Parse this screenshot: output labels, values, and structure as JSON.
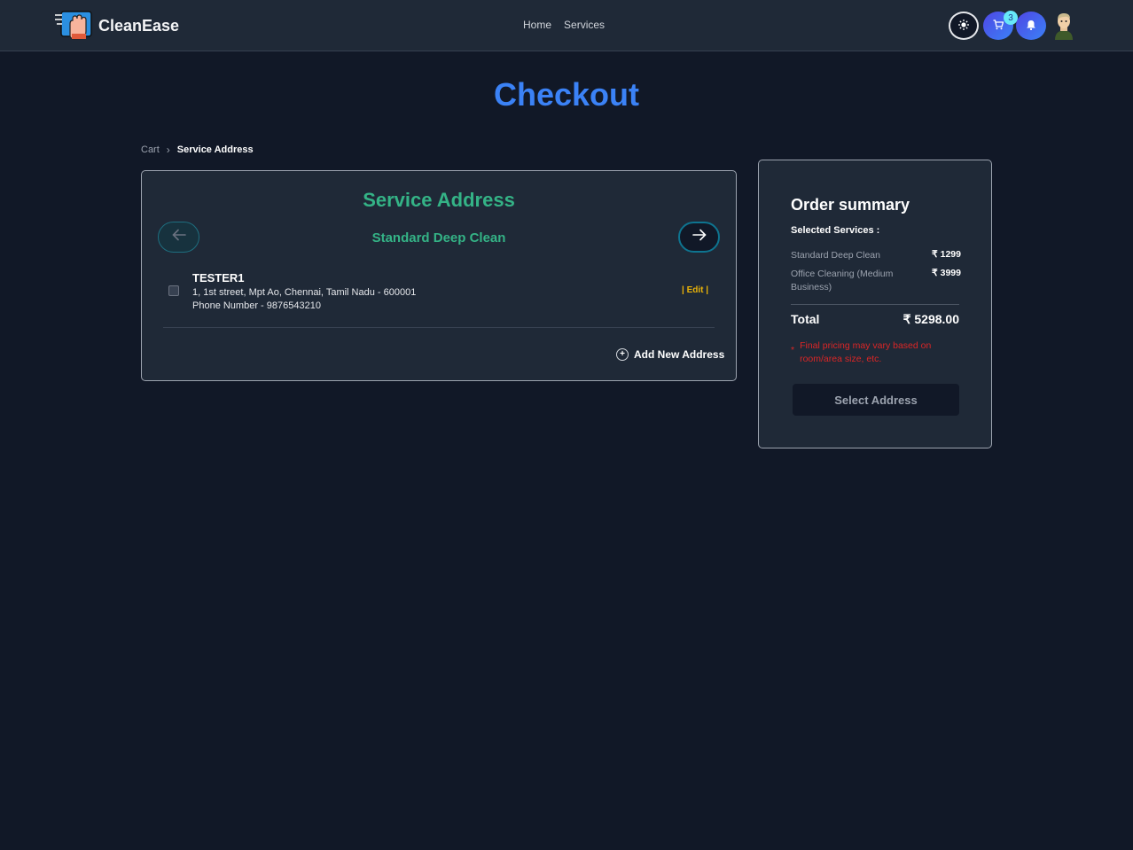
{
  "header": {
    "brand": "CleanEase",
    "nav": [
      "Home",
      "Services"
    ],
    "cart_count": "3",
    "icons": {
      "logo": "cleaning-hand-icon",
      "theme": "sun-icon",
      "cart": "cart-icon",
      "bell": "bell-icon"
    }
  },
  "page": {
    "title": "Checkout"
  },
  "breadcrumb": {
    "cart": "Cart",
    "separator": "›",
    "current": "Service Address"
  },
  "address_panel": {
    "title": "Service Address",
    "service_name": "Standard Deep Clean",
    "addresses": [
      {
        "name": "TESTER1",
        "line": "1, 1st street, Mpt Ao, Chennai, Tamil Nadu - 600001",
        "phone": "Phone Number - 9876543210",
        "edit_label": "| Edit |"
      }
    ],
    "add_new_label": "Add New Address"
  },
  "summary": {
    "title": "Order summary",
    "selected_label": "Selected Services :",
    "items": [
      {
        "name": "Standard Deep Clean",
        "price": "₹ 1299"
      },
      {
        "name": "Office Cleaning (Medium Business)",
        "price": "₹ 3999"
      }
    ],
    "total_label": "Total",
    "total_value": "₹ 5298.00",
    "note": "Final pricing may vary based on room/area size, etc.",
    "note_marker": "*",
    "button_label": "Select Address"
  },
  "colors": {
    "accent_blue": "#3b82f6",
    "accent_green": "#34b386",
    "edit_yellow": "#eab308",
    "note_red": "#dc2626"
  }
}
